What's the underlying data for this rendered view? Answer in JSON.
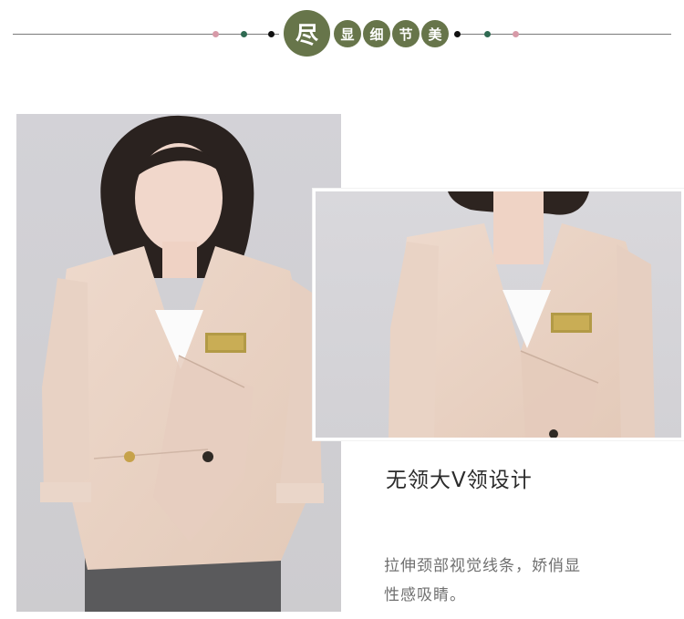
{
  "header": {
    "badges": [
      "尽",
      "显",
      "细",
      "节",
      "美"
    ],
    "colors": {
      "badge": "#67754a",
      "rule": "#7a7a7a",
      "dot_pink": "#d79aa8",
      "dot_green": "#2f6a52",
      "dot_black": "#111111"
    }
  },
  "photos": {
    "main": "model-in-beige-jacket-front-photo",
    "detail": "beige-jacket-v-neck-closeup-photo"
  },
  "feature": {
    "title": "无领大V领设计",
    "description_lines": [
      "拉伸颈部视觉线条，娇俏显",
      "性感吸睛。"
    ]
  },
  "colors": {
    "jacket": "#ead4c6",
    "background_photo": "#d6d5d9"
  }
}
